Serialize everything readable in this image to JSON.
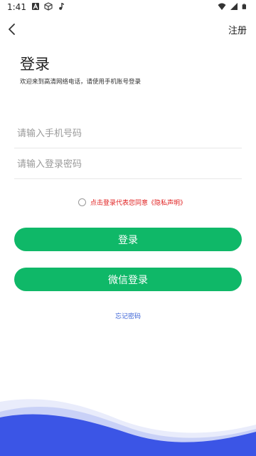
{
  "status_bar": {
    "time": "1:41",
    "left_icons": [
      "a-icon",
      "cube-icon",
      "music-note-icon"
    ],
    "right_icons": [
      "wifi-icon",
      "signal-icon",
      "battery-icon"
    ]
  },
  "topbar": {
    "register_label": "注册"
  },
  "header": {
    "title": "登录",
    "subtitle": "欢迎来到高清网络电话，请使用手机账号登录"
  },
  "form": {
    "phone_placeholder": "请输入手机号码",
    "phone_value": "",
    "password_placeholder": "请输入登录密码",
    "password_value": ""
  },
  "consent": {
    "text": "点击登录代表您同意《隐私声明》",
    "checked": false
  },
  "buttons": {
    "login_label": "登录",
    "wechat_login_label": "微信登录"
  },
  "links": {
    "forgot_password": "忘记密码"
  },
  "colors": {
    "primary_green": "#0fb868",
    "consent_red": "#e02020",
    "link_blue": "#3a62d6",
    "wave_blue": "#3b55e6"
  }
}
